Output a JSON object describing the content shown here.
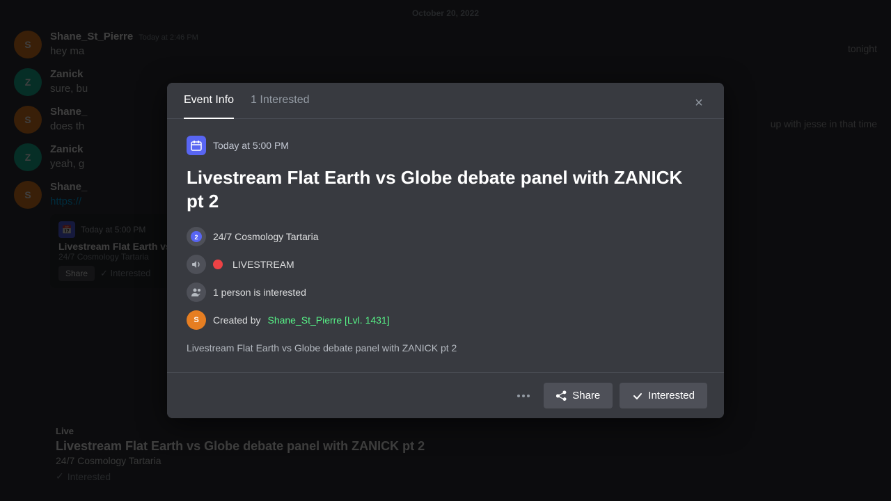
{
  "background": {
    "date_divider": "October 20, 2022",
    "messages": [
      {
        "username": "Shane_St_Pierre",
        "time": "Today at 2:46 PM",
        "text": "hey ma",
        "avatar_letter": "S",
        "avatar_color": "orange"
      },
      {
        "username": "Zanick",
        "time": "",
        "text": "sure, bu",
        "avatar_letter": "Z",
        "avatar_color": "teal"
      },
      {
        "username": "Shane_",
        "time": "",
        "text": "does th",
        "avatar_letter": "S",
        "avatar_color": "orange"
      },
      {
        "username": "Zanick",
        "time": "",
        "text": "yeah, g",
        "avatar_letter": "Z",
        "avatar_color": "teal"
      },
      {
        "username": "Shane_",
        "time": "",
        "text": "https://",
        "avatar_letter": "S",
        "avatar_color": "orange"
      }
    ],
    "bg_right_text": "up with jesse in that time"
  },
  "modal": {
    "tab_event_info": "Event Info",
    "tab_interested": "1 Interested",
    "close_label": "×",
    "datetime": "Today at 5:00 PM",
    "title": "Livestream Flat Earth vs Globe debate panel with ZANICK pt 2",
    "organizer": "24/7 Cosmology Tartaria",
    "livestream_label": "LIVESTREAM",
    "interested_count": "1 person is interested",
    "creator_prefix": "Created by ",
    "creator_name": "Shane_St_Pierre [Lvl. 1431]",
    "description": "Livestream  Flat Earth vs Globe debate panel with ZANICK pt 2",
    "share_label": "Share",
    "interested_label": "Interested",
    "more_dots": "···"
  },
  "bottom_card": {
    "title": "Live",
    "event_title": "Livestream Flat Earth vs Globe debate panel with ZANICK pt 2",
    "organizer": "24/7 Cosmology Tartaria",
    "interested_check": "✓",
    "interested_label": "Interested"
  },
  "colors": {
    "accent_green": "#57f287",
    "tab_active_border": "#ffffff",
    "live_red": "#ed4245",
    "modal_bg": "#383a40",
    "footer_bg": "#383a40"
  }
}
